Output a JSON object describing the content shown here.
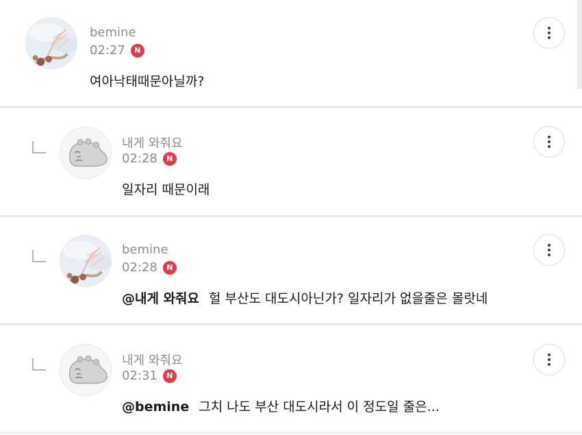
{
  "comments": [
    {
      "nickname": "bemine",
      "time": "02:27",
      "badge": "N",
      "mention": "",
      "text": "여아낙태때문아닐까?",
      "avatar_icon": "net-photo-avatar",
      "is_reply": false
    },
    {
      "nickname": "내게 와줘요",
      "time": "02:28",
      "badge": "N",
      "mention": "",
      "text": "일자리 때문이래",
      "avatar_icon": "gray-creature-avatar",
      "is_reply": true
    },
    {
      "nickname": "bemine",
      "time": "02:28",
      "badge": "N",
      "mention": "@내게 와줘요",
      "text": "헐 부산도 대도시아닌가? 일자리가 없을줄은 몰랏네",
      "avatar_icon": "net-photo-avatar",
      "is_reply": true
    },
    {
      "nickname": "내게 와줘요",
      "time": "02:31",
      "badge": "N",
      "mention": "@bemine",
      "text": "그치 나도 부산 대도시라서 이 정도일 줄은...",
      "avatar_icon": "gray-creature-avatar",
      "is_reply": true
    }
  ],
  "colors": {
    "badge": "#e03c4a",
    "meta_text": "#8c8c8c",
    "body_text": "#1a1a1a",
    "divider": "#e9e9e9"
  },
  "icons": {
    "more": "vertical-ellipsis-icon",
    "reply": "reply-corner-icon"
  }
}
